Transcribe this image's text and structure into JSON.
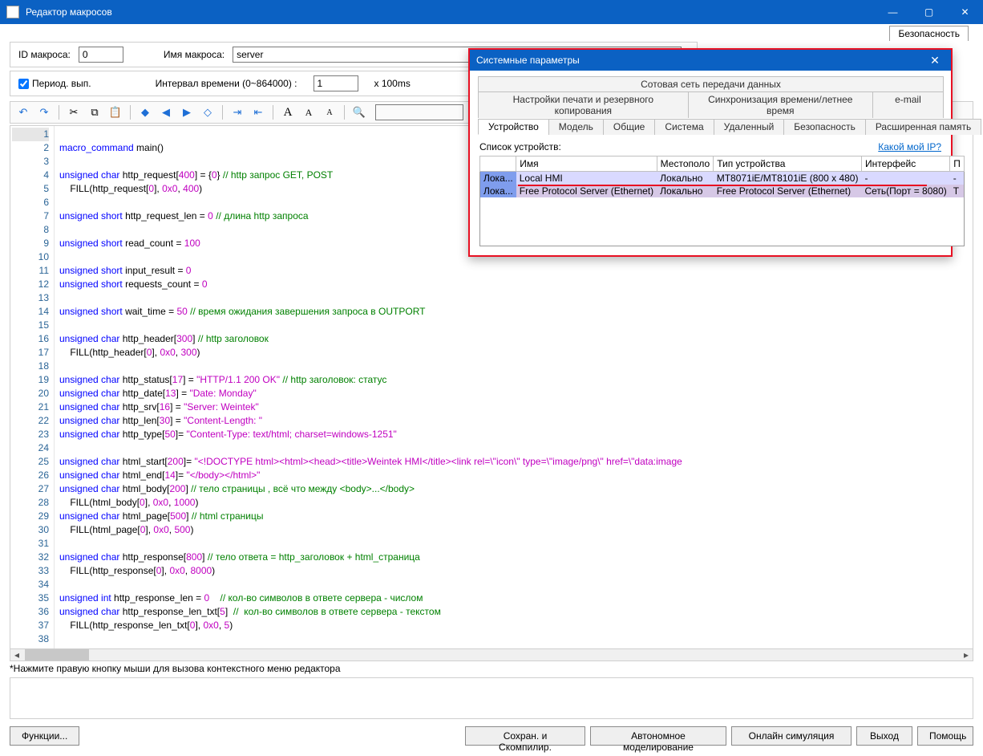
{
  "window": {
    "title": "Редактор макросов"
  },
  "header": {
    "id_label": "ID макроса:",
    "id_value": "0",
    "name_label": "Имя макроса:",
    "name_value": "server",
    "periodic_label": "Период. вып.",
    "interval_label": "Интервал времени (0~864000) :",
    "interval_value": "1",
    "interval_unit": "x 100ms",
    "bg_tab": "Безопасность"
  },
  "hint": "*Нажмите правую кнопку мыши для вызова контекстного меню редактора",
  "buttons": {
    "functions": "Функции...",
    "save_compile": "Сохран. и Скомпилир.",
    "offline_sim": "Автономное моделирование",
    "online_sim": "Онлайн симуляция",
    "exit": "Выход",
    "help": "Помощь"
  },
  "popup": {
    "title": "Системные параметры",
    "tab_banner": "Сотовая сеть передачи данных",
    "tabs_row1": [
      "Настройки печати и резервного копирования",
      "Синхронизация времени/летнее время",
      "e-mail"
    ],
    "tabs_row2": [
      "Устройство",
      "Модель",
      "Общие",
      "Система",
      "Удаленный",
      "Безопасность",
      "Расширенная память"
    ],
    "active_tab": "Устройство",
    "device_list_label": "Список устройств:",
    "my_ip": "Какой мой IP?",
    "cols": [
      "",
      "Имя",
      "Местополо",
      "Тип устройства",
      "Интерфейс",
      "П"
    ],
    "rows": [
      {
        "c0": "Лока...",
        "name": "Local HMI",
        "loc": "Локально",
        "type": "MT8071iE/MT8101iE (800 x 480)",
        "iface": "-",
        "p": "-"
      },
      {
        "c0": "Лока...",
        "name": "Free Protocol Server (Ethernet)",
        "loc": "Локально",
        "type": "Free Protocol Server (Ethernet)",
        "iface": "Сеть(Порт = 8080)",
        "p": "Т"
      }
    ]
  },
  "code": [
    {
      "n": 1,
      "raw": ""
    },
    {
      "n": 2,
      "html": "<span class='kw'>macro_command</span> main()"
    },
    {
      "n": 3,
      "raw": ""
    },
    {
      "n": 4,
      "html": "<span class='ty'>unsigned char</span> http_request[<span class='num'>400</span>] = {<span class='num'>0</span>} <span class='cmt'>// http запрос GET, POST</span>"
    },
    {
      "n": 5,
      "html": "    FILL(http_request[<span class='num'>0</span>], <span class='num'>0x0</span>, <span class='num'>400</span>)"
    },
    {
      "n": 6,
      "raw": ""
    },
    {
      "n": 7,
      "html": "<span class='ty'>unsigned short</span> http_request_len = <span class='num'>0</span> <span class='cmt'>// длина http запроса</span>"
    },
    {
      "n": 8,
      "raw": ""
    },
    {
      "n": 9,
      "html": "<span class='ty'>unsigned short</span> read_count = <span class='num'>100</span>"
    },
    {
      "n": 10,
      "raw": ""
    },
    {
      "n": 11,
      "html": "<span class='ty'>unsigned short</span> input_result = <span class='num'>0</span>"
    },
    {
      "n": 12,
      "html": "<span class='ty'>unsigned short</span> requests_count = <span class='num'>0</span>"
    },
    {
      "n": 13,
      "raw": ""
    },
    {
      "n": 14,
      "html": "<span class='ty'>unsigned short</span> wait_time = <span class='num'>50</span> <span class='cmt'>// время ожидания завершения запроса в OUTPORT</span>"
    },
    {
      "n": 15,
      "raw": ""
    },
    {
      "n": 16,
      "html": "<span class='ty'>unsigned char</span> http_header[<span class='num'>300</span>] <span class='cmt'>// http заголовок</span>"
    },
    {
      "n": 17,
      "html": "    FILL(http_header[<span class='num'>0</span>], <span class='num'>0x0</span>, <span class='num'>300</span>)"
    },
    {
      "n": 18,
      "raw": ""
    },
    {
      "n": 19,
      "html": "<span class='ty'>unsigned char</span> http_status[<span class='num'>17</span>] = <span class='str'>\"HTTP/1.1 200 OK\"</span> <span class='cmt'>// http заголовок: статус</span>"
    },
    {
      "n": 20,
      "html": "<span class='ty'>unsigned char</span> http_date[<span class='num'>13</span>] = <span class='str'>\"Date: Monday\"</span>"
    },
    {
      "n": 21,
      "html": "<span class='ty'>unsigned char</span> http_srv[<span class='num'>16</span>] = <span class='str'>\"Server: Weintek\"</span>"
    },
    {
      "n": 22,
      "html": "<span class='ty'>unsigned char</span> http_len[<span class='num'>30</span>] = <span class='str'>\"Content-Length: \"</span>"
    },
    {
      "n": 23,
      "html": "<span class='ty'>unsigned char</span> http_type[<span class='num'>50</span>]= <span class='str'>\"Content-Type: text/html; charset=windows-1251\"</span>"
    },
    {
      "n": 24,
      "raw": ""
    },
    {
      "n": 25,
      "html": "<span class='ty'>unsigned char</span> html_start[<span class='num'>200</span>]= <span class='str'>\"&lt;!DOCTYPE html&gt;&lt;html&gt;&lt;head&gt;&lt;title&gt;Weintek HMI&lt;/title&gt;&lt;link rel=\\\"icon\\\" type=\\\"image/png\\\" href=\\\"data:image</span>"
    },
    {
      "n": 26,
      "html": "<span class='ty'>unsigned char</span> html_end[<span class='num'>14</span>]= <span class='str'>\"&lt;/body&gt;&lt;/html&gt;\"</span>"
    },
    {
      "n": 27,
      "html": "<span class='ty'>unsigned char</span> html_body[<span class='num'>200</span>] <span class='cmt'>// тело страницы , всё что между &lt;body&gt;...&lt;/body&gt;</span>"
    },
    {
      "n": 28,
      "html": "    FILL(html_body[<span class='num'>0</span>], <span class='num'>0x0</span>, <span class='num'>1000</span>)"
    },
    {
      "n": 29,
      "html": "<span class='ty'>unsigned char</span> html_page[<span class='num'>500</span>] <span class='cmt'>// html страницы</span>"
    },
    {
      "n": 30,
      "html": "    FILL(html_page[<span class='num'>0</span>], <span class='num'>0x0</span>, <span class='num'>500</span>)"
    },
    {
      "n": 31,
      "raw": ""
    },
    {
      "n": 32,
      "html": "<span class='ty'>unsigned char</span> http_response[<span class='num'>800</span>] <span class='cmt'>// тело ответа = http_заголовок + html_страница</span>"
    },
    {
      "n": 33,
      "html": "    FILL(http_response[<span class='num'>0</span>], <span class='num'>0x0</span>, <span class='num'>8000</span>)"
    },
    {
      "n": 34,
      "raw": ""
    },
    {
      "n": 35,
      "html": "<span class='ty'>unsigned int</span> http_response_len = <span class='num'>0</span>    <span class='cmt'>// кол-во символов в ответе сервера - числом</span>"
    },
    {
      "n": 36,
      "html": "<span class='ty'>unsigned char</span> http_response_len_txt[<span class='num'>5</span>]  <span class='cmt'>//  кол-во символов в ответе сервера - текстом</span>"
    },
    {
      "n": 37,
      "html": "    FILL(http_response_len_txt[<span class='num'>0</span>], <span class='num'>0x0</span>, <span class='num'>5</span>)"
    },
    {
      "n": 38,
      "raw": ""
    }
  ]
}
